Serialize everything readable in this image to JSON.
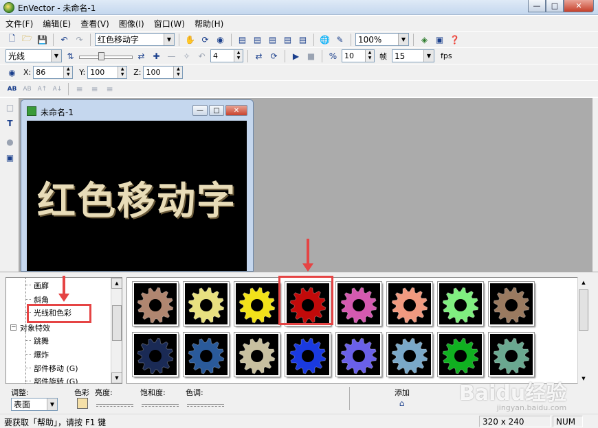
{
  "app": {
    "title": "EnVector - 未命名-1"
  },
  "menu": [
    "文件(F)",
    "编辑(E)",
    "查看(V)",
    "图像(I)",
    "窗口(W)",
    "帮助(H)"
  ],
  "toolbar1": {
    "text_combo": "红色移动字",
    "zoom_combo": "100%"
  },
  "toolbar2": {
    "effect_combo": "光线",
    "frame_value": "4",
    "fps_value": "10",
    "frame_label": "帧",
    "frames_combo": "15",
    "fps_label": "fps"
  },
  "toolbar3": {
    "x_label": "X:",
    "x_value": "86",
    "y_label": "Y:",
    "y_value": "100",
    "z_label": "Z:",
    "z_value": "100"
  },
  "child_window": {
    "title": "未命名-1",
    "canvas_text": "红色移动字"
  },
  "tree": {
    "items": [
      "画廊",
      "斜角",
      "光线和色彩",
      "对象特效",
      "跳舞",
      "爆炸",
      "部件移动 (G)",
      "部件旋转 (G)"
    ]
  },
  "gallery": {
    "row1_colors": [
      "#b08670",
      "#e8e080",
      "#f2e21a",
      "#c20a0a",
      "#d45ab0",
      "#f09a80",
      "#80ee80",
      "#9a7a60"
    ],
    "row2_colors": [
      "#1a2a55",
      "#2a5a9a",
      "#c8c0a0",
      "#1a3ae0",
      "#6a60e8",
      "#7aa8c8",
      "#10b020",
      "#6aa890"
    ],
    "selected_index": 3
  },
  "adjust": {
    "adjust_label": "调整:",
    "surface_combo": "表面",
    "color_label": "色彩",
    "brightness_label": "亮度:",
    "saturation_label": "饱和度:",
    "hue_label": "色调:",
    "add_label": "添加"
  },
  "status": {
    "help_text": "要获取「帮助」，请按 F1 键",
    "size": "320 x 240",
    "num": "NUM"
  },
  "watermark": {
    "text": "Baidu经验",
    "sub": "jingyan.baidu.com"
  },
  "colors": {
    "highlight": "#e54444",
    "mdi_bg": "#ababab",
    "canvas_text": "#e8dcb8"
  }
}
